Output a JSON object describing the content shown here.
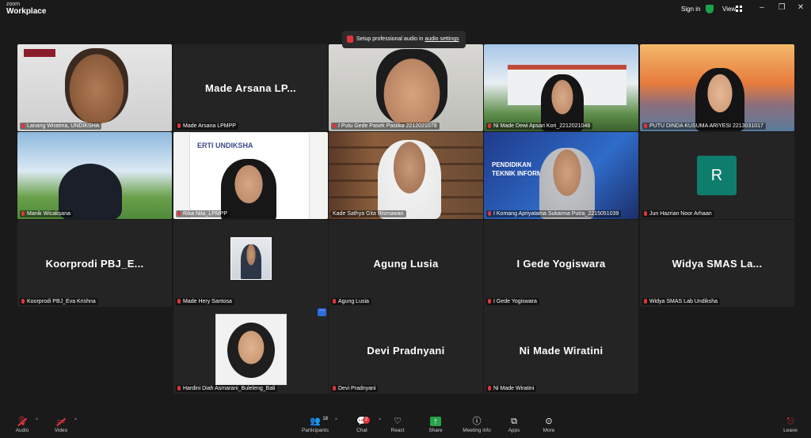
{
  "app": {
    "brand_small": "zoom",
    "brand_big": "Workplace"
  },
  "titlebar": {
    "sign_in": "Sign in",
    "view": "View"
  },
  "popup": {
    "text_pre": "Setup professional audio in ",
    "link": "audio settings",
    "text_post": ""
  },
  "tiles": [
    {
      "id": "t1",
      "name": "Lanang Wiratma, UNDIKSHA",
      "display": ""
    },
    {
      "id": "t2",
      "name": "Made Arsana LPMPP",
      "display": "Made  Arsana  LP..."
    },
    {
      "id": "t3",
      "name": "I Putu Gede Pasek Pastika 2212021078",
      "display": ""
    },
    {
      "id": "t4",
      "name": "Ni Made Dewi Apsari Kori_2212021048",
      "display": ""
    },
    {
      "id": "t5",
      "name": "PUTU DINDA KUSUMA ARIYESI 2213031017",
      "display": ""
    },
    {
      "id": "t6",
      "name": "Manik Wicaksana",
      "display": ""
    },
    {
      "id": "t7",
      "name": "Rika Nita_LPMPP",
      "display": "",
      "poster_title": "ERTI UNDIKSHA"
    },
    {
      "id": "t8",
      "name": "Kade Sathya Gita Rismawan",
      "display": ""
    },
    {
      "id": "t9",
      "name": "I Komang Apriyatama Sukarma Putra_2215051039",
      "display": "",
      "poster_lines": [
        "PENDIDIKAN",
        "TEKNIK INFORMATI"
      ]
    },
    {
      "id": "t10",
      "name": "Jun Hazrian Noor Arhaan",
      "display": "",
      "avatar_letter": "R"
    },
    {
      "id": "t11",
      "name": "Koorprodi PBJ_Eva Krishna",
      "display": "Koorprodi  PBJ_E..."
    },
    {
      "id": "t12",
      "name": "Made Hery Santosa",
      "display": ""
    },
    {
      "id": "t13",
      "name": "Agung Lusia",
      "display": "Agung Lusia"
    },
    {
      "id": "t14",
      "name": "I Gede Yogiswara",
      "display": "I Gede Yogiswara"
    },
    {
      "id": "t15",
      "name": "Widya SMAS Lab Undiksha",
      "display": "Widya  SMAS  La..."
    },
    {
      "id": "t16",
      "name": "Hardini Diah Asmarani_Buleleng_Bali",
      "display": ""
    },
    {
      "id": "t17",
      "name": "Devi Pradnyani",
      "display": "Devi Pradnyani"
    },
    {
      "id": "t18",
      "name": "Ni Made Wiratini",
      "display": "Ni Made Wiratini"
    }
  ],
  "toolbar": {
    "audio": "Audio",
    "video": "Video",
    "participants": "Participants",
    "participants_count": "18",
    "chat": "Chat",
    "chat_badge": "2",
    "react": "React",
    "share": "Share",
    "meeting_info": "Meeting info",
    "apps": "Apps",
    "more": "More",
    "leave": "Leave"
  },
  "colors": {
    "background": "#1a1a1a",
    "tile": "#242424",
    "active_border": "#2da84d",
    "mute_red": "#e0343c",
    "share_green": "#27a34a",
    "avatar_teal": "#0e7d6c"
  },
  "icons": [
    "shield-icon",
    "view-grid-icon",
    "minimize-icon",
    "restore-icon",
    "close-icon",
    "mic-muted-icon",
    "video-off-icon",
    "participants-icon",
    "chat-icon",
    "react-heart-icon",
    "share-up-arrow-icon",
    "info-icon",
    "apps-icon",
    "more-dots-icon",
    "leave-icon"
  ]
}
